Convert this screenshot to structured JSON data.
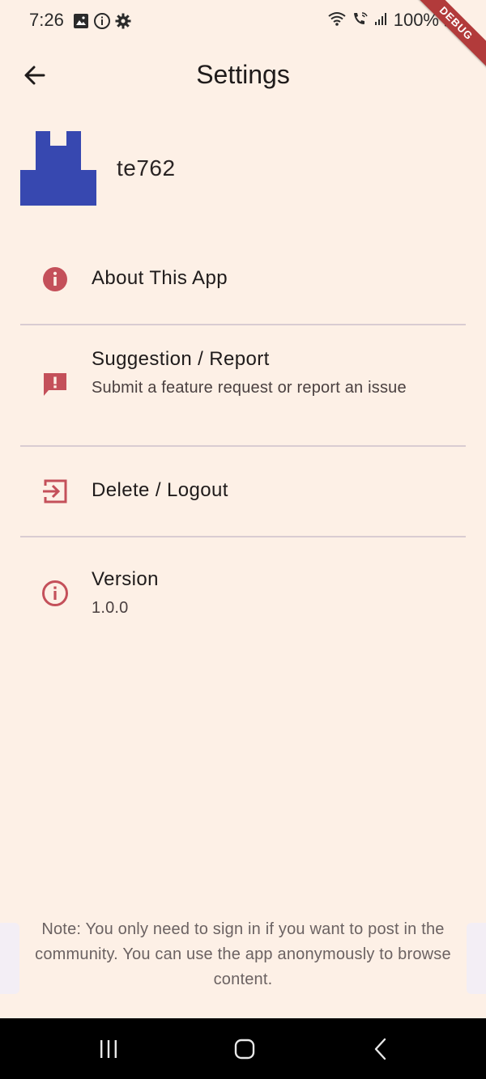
{
  "status_bar": {
    "time": "7:26",
    "battery": "100%",
    "icons_left": [
      "image-icon",
      "info-icon",
      "settings-icon"
    ],
    "icons_right": [
      "wifi-icon",
      "wifi-calling-icon",
      "signal-icon",
      "battery-icon"
    ]
  },
  "debug_banner": {
    "label": "DEBUG"
  },
  "app_bar": {
    "title": "Settings"
  },
  "profile": {
    "username": "te762"
  },
  "menu": {
    "items": [
      {
        "title": "About This App",
        "subtitle": "",
        "icon": "info-filled-icon"
      },
      {
        "title": "Suggestion / Report",
        "subtitle": "Submit a feature request or report an issue",
        "icon": "feedback-icon"
      },
      {
        "title": "Delete / Logout",
        "subtitle": "",
        "icon": "logout-icon"
      },
      {
        "title": "Version",
        "subtitle": "1.0.0",
        "icon": "info-outline-icon"
      }
    ]
  },
  "footer": {
    "note": "Note: You only need to sign in if you want to post in the community. You can use the app anonymously to browse content."
  },
  "nav_bar": {
    "buttons": [
      "recents-button",
      "home-button",
      "back-button"
    ]
  },
  "colors": {
    "background": "#fdf0e6",
    "accent": "#c4505a",
    "avatar": "#3748b0",
    "divider": "#d9ccd2"
  }
}
